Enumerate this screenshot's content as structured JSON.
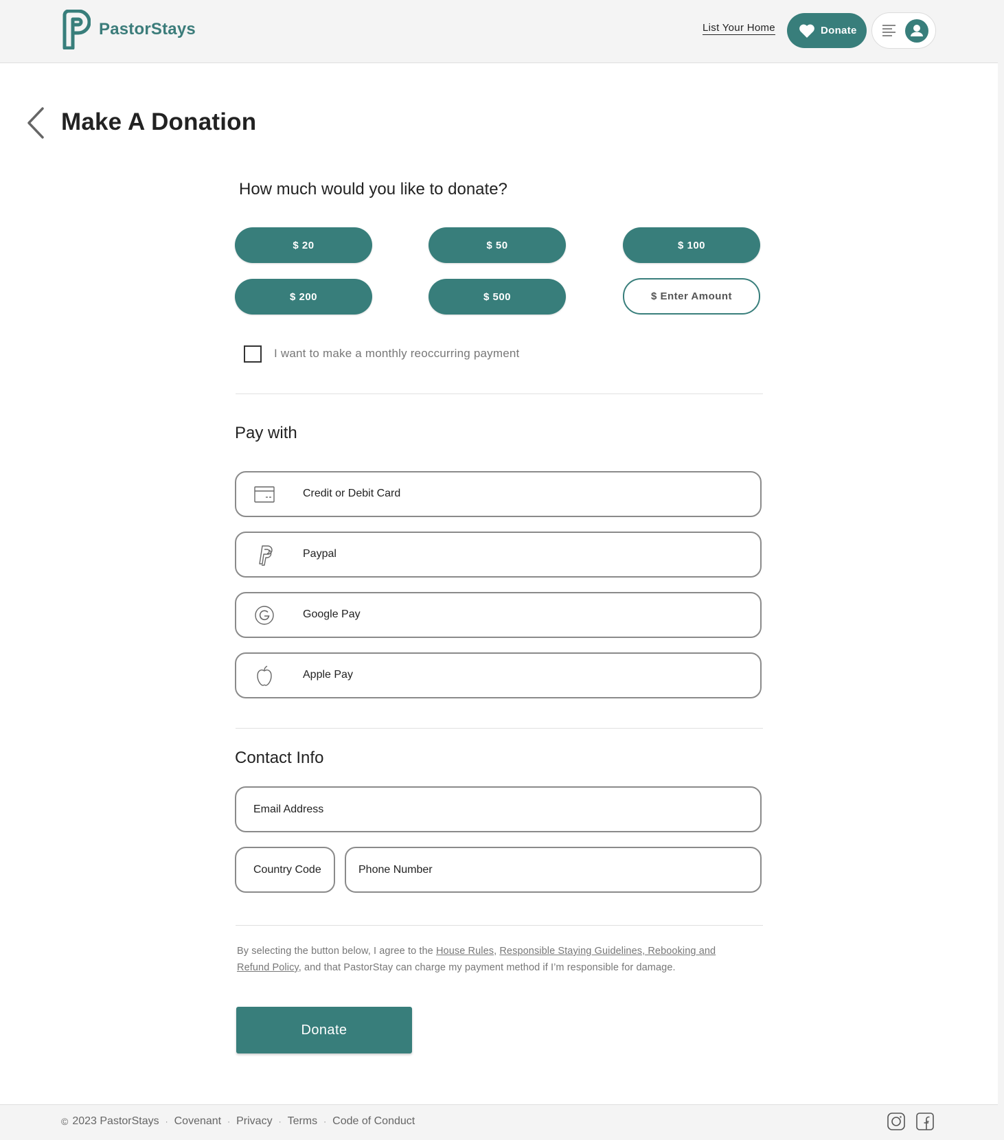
{
  "header": {
    "brand": "PastorStays",
    "list_home": "List Your Home",
    "donate": "Donate",
    "menu_icon": "hamburger-icon",
    "avatar_icon": "user-icon"
  },
  "page": {
    "title": "Make A Donation"
  },
  "amounts": {
    "question": "How much would you like to donate?",
    "options": [
      "$ 20",
      "$ 50",
      "$ 100",
      "$ 200",
      "$ 500"
    ],
    "custom_label": "$ Enter Amount",
    "recurring_label": "I want to make a monthly reoccurring payment",
    "recurring_checked": false
  },
  "pay": {
    "title": "Pay with",
    "methods": [
      {
        "label": "Credit or Debit Card",
        "icon": "credit-card-icon"
      },
      {
        "label": "Paypal",
        "icon": "paypal-icon"
      },
      {
        "label": "Google Pay",
        "icon": "google-icon"
      },
      {
        "label": "Apple Pay",
        "icon": "apple-icon"
      }
    ]
  },
  "contact": {
    "title": "Contact Info",
    "email_placeholder": "Email Address",
    "country_placeholder": "Country Code",
    "phone_placeholder": "Phone Number"
  },
  "terms": {
    "prefix": "By selecting the button below, I agree to the ",
    "house_rules": "House Rules",
    "sep": ", ",
    "guidelines": "Responsible Staying Guidelines, Rebooking and Refund Policy",
    "suffix": ", and that PastorStay can charge my payment method if I’m responsible for damage."
  },
  "submit": {
    "label": "Donate"
  },
  "footer": {
    "copyright": "2023 PastorStays",
    "links": [
      "Covenant",
      "Privacy",
      "Terms",
      "Code of Conduct"
    ],
    "social_icons": [
      "instagram-icon",
      "facebook-icon"
    ]
  },
  "colors": {
    "brand": "#387e7b",
    "header_bg": "#f4f4f4",
    "border": "#8a8a8a"
  }
}
